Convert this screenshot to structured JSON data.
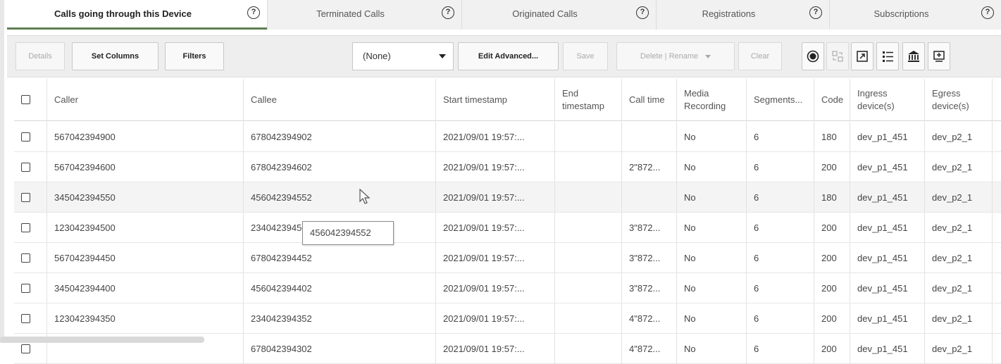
{
  "tabs": [
    {
      "label": "Calls going through this Device",
      "active": true
    },
    {
      "label": "Terminated Calls",
      "active": false
    },
    {
      "label": "Originated Calls",
      "active": false
    },
    {
      "label": "Registrations",
      "active": false
    },
    {
      "label": "Subscriptions",
      "active": false
    }
  ],
  "help_glyph": "?",
  "toolbar": {
    "details": "Details",
    "set_columns": "Set Columns",
    "filters": "Filters",
    "select_value": "(None)",
    "edit_advanced": "Edit Advanced...",
    "save": "Save",
    "delete_rename": "Delete | Rename",
    "clear": "Clear"
  },
  "columns": [
    "Caller",
    "Callee",
    "Start timestamp",
    "End timestamp",
    "Call time",
    "Media Recording",
    "Segments...",
    "Code",
    "Ingress device(s)",
    "Egress device(s)"
  ],
  "rows": [
    {
      "caller": "567042394900",
      "callee": "678042394902",
      "start": "2021/09/01 19:57:...",
      "end": "",
      "call_time": "",
      "media": "No",
      "segments": "6",
      "code": "180",
      "ingress": "dev_p1_451",
      "egress": "dev_p2_1"
    },
    {
      "caller": "567042394600",
      "callee": "678042394602",
      "start": "2021/09/01 19:57:...",
      "end": "",
      "call_time": "2\"872...",
      "media": "No",
      "segments": "6",
      "code": "200",
      "ingress": "dev_p1_451",
      "egress": "dev_p2_1"
    },
    {
      "caller": "345042394550",
      "callee": "456042394552",
      "start": "2021/09/01 19:57:...",
      "end": "",
      "call_time": "",
      "media": "No",
      "segments": "6",
      "code": "180",
      "ingress": "dev_p1_451",
      "egress": "dev_p2_1"
    },
    {
      "caller": "123042394500",
      "callee": "234042394502",
      "start": "2021/09/01 19:57:...",
      "end": "",
      "call_time": "3\"872...",
      "media": "No",
      "segments": "6",
      "code": "200",
      "ingress": "dev_p1_451",
      "egress": "dev_p2_1"
    },
    {
      "caller": "567042394450",
      "callee": "678042394452",
      "start": "2021/09/01 19:57:...",
      "end": "",
      "call_time": "3\"872...",
      "media": "No",
      "segments": "6",
      "code": "200",
      "ingress": "dev_p1_451",
      "egress": "dev_p2_1"
    },
    {
      "caller": "345042394400",
      "callee": "456042394402",
      "start": "2021/09/01 19:57:...",
      "end": "",
      "call_time": "3\"872...",
      "media": "No",
      "segments": "6",
      "code": "200",
      "ingress": "dev_p1_451",
      "egress": "dev_p2_1"
    },
    {
      "caller": "123042394350",
      "callee": "234042394352",
      "start": "2021/09/01 19:57:...",
      "end": "",
      "call_time": "4\"872...",
      "media": "No",
      "segments": "6",
      "code": "200",
      "ingress": "dev_p1_451",
      "egress": "dev_p2_1"
    },
    {
      "caller": "",
      "callee": "678042394302",
      "start": "2021/09/01 19:57:...",
      "end": "",
      "call_time": "4\"872...",
      "media": "No",
      "segments": "6",
      "code": "200",
      "ingress": "dev_p1_451",
      "egress": "dev_p2_1"
    }
  ],
  "hovered_row": 2,
  "tooltip": "456042394552",
  "colors": {
    "active_tab_underline": "#5f7f52",
    "toolbar_bg": "#eeeeee"
  }
}
